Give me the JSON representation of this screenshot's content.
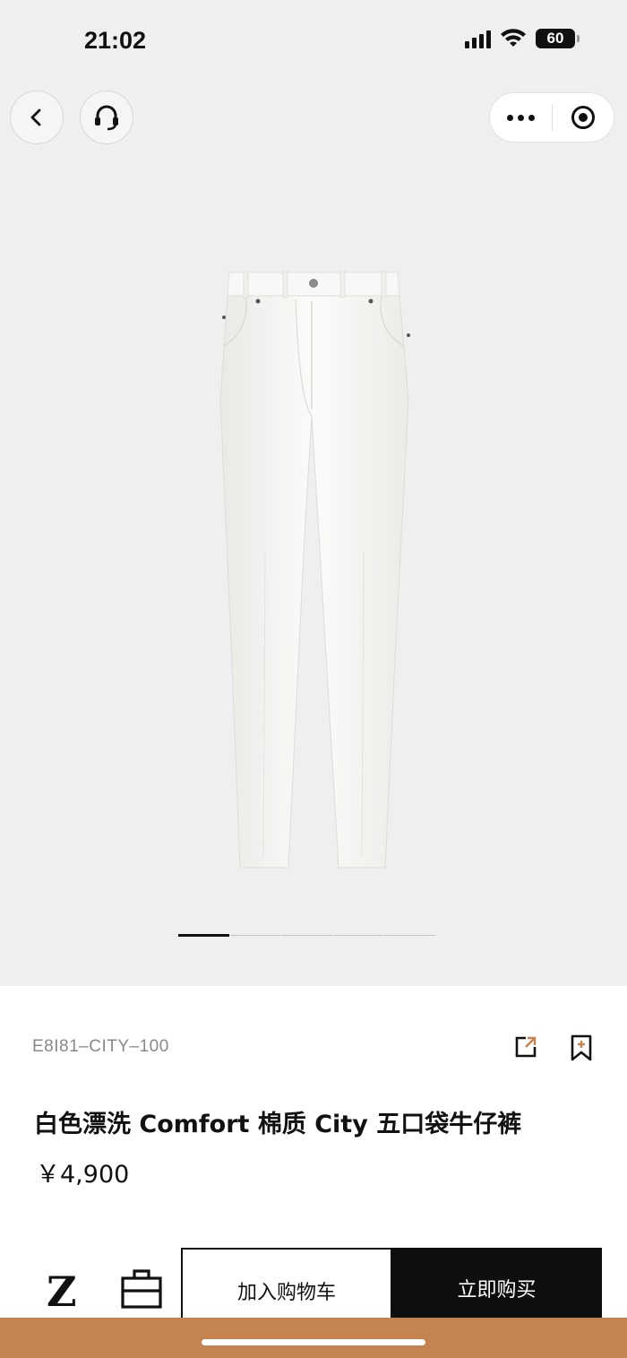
{
  "status_bar": {
    "time": "21:02",
    "battery": "60",
    "icons": [
      "signal-icon",
      "wifi-icon",
      "battery-icon"
    ]
  },
  "nav": {
    "icons": [
      "back-icon",
      "customer-service-icon",
      "more-icon",
      "close-miniprogram-icon"
    ]
  },
  "carousel": {
    "image_count": 5,
    "active_index": 0
  },
  "product": {
    "sku": "E8I81–CITY–100",
    "title": "白色漂洗 Comfort 棉质 City 五口袋牛仔裤",
    "price": "￥4,900",
    "icons": [
      "share-icon",
      "bookmark-add-icon"
    ]
  },
  "bottom_bar": {
    "logo": "Z",
    "add_to_cart": "加入购物车",
    "buy_now": "立即购买",
    "icons": [
      "shopping-bag-icon"
    ]
  },
  "colors": {
    "hero_background": "#efefef",
    "buy_button": "#0e0e0e",
    "bottom_band": "#c5834f"
  }
}
